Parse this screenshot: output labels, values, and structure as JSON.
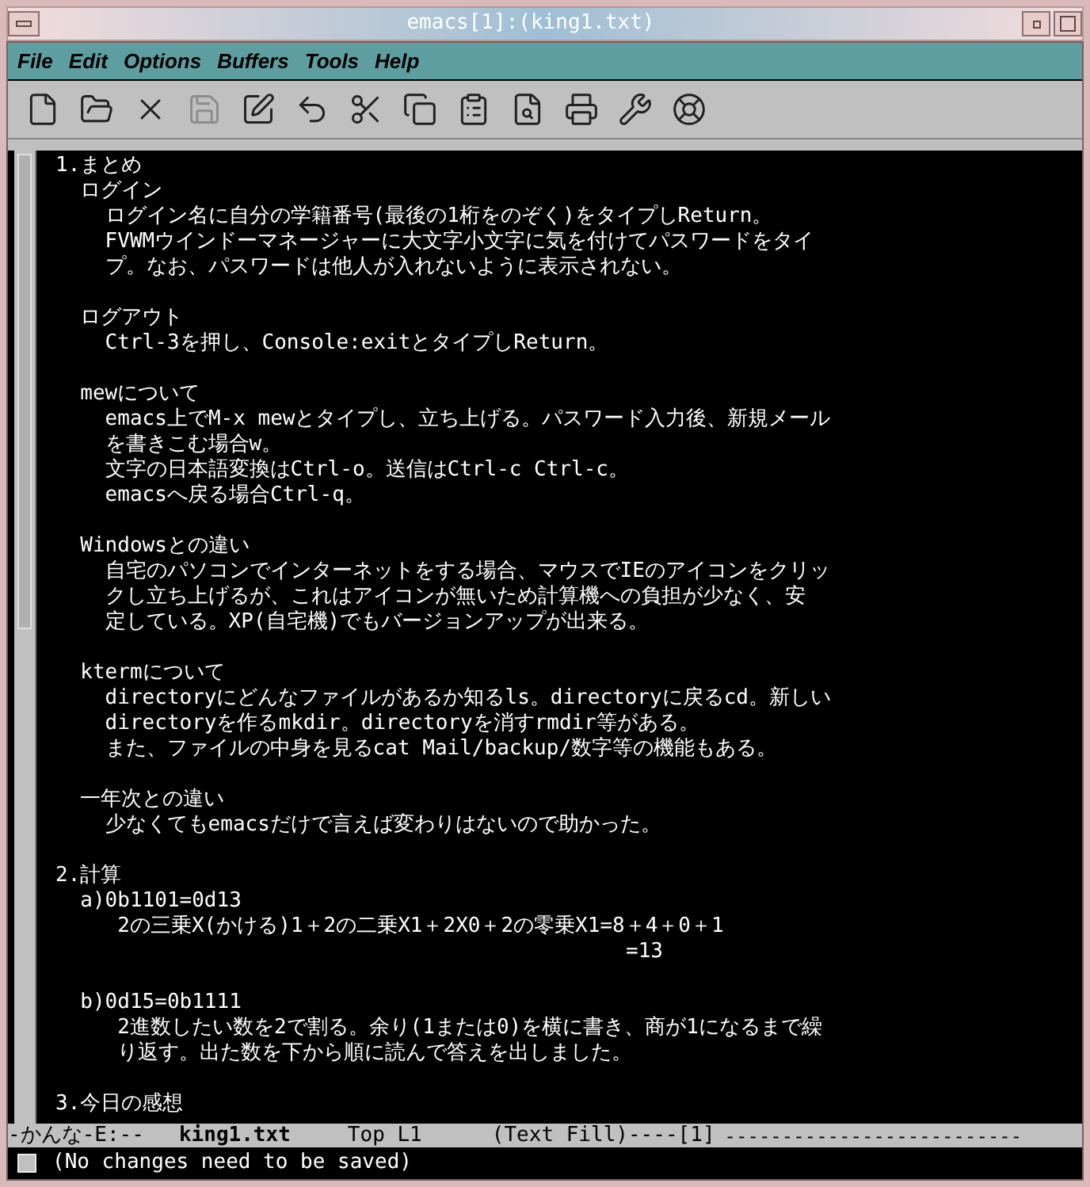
{
  "window": {
    "title": "emacs[1]:(king1.txt)"
  },
  "menu": [
    "File",
    "Edit",
    "Options",
    "Buffers",
    "Tools",
    "Help"
  ],
  "toolbar": [
    {
      "kind": "new",
      "disabled": false
    },
    {
      "kind": "open",
      "disabled": false
    },
    {
      "kind": "close",
      "disabled": false
    },
    {
      "kind": "save",
      "disabled": true
    },
    {
      "kind": "save-as",
      "disabled": false
    },
    {
      "kind": "undo",
      "disabled": false
    },
    {
      "kind": "cut",
      "disabled": false
    },
    {
      "kind": "copy",
      "disabled": false
    },
    {
      "kind": "paste",
      "disabled": false
    },
    {
      "kind": "search",
      "disabled": false
    },
    {
      "kind": "print",
      "disabled": false
    },
    {
      "kind": "tools",
      "disabled": false
    },
    {
      "kind": "help",
      "disabled": false
    }
  ],
  "buffer": [
    [
      "1.まとめ",
      "  ログイン",
      "    ログイン名に自分の学籍番号(最後の1桁をのぞく)をタイプしReturn。",
      "    FVWMウインドーマネージャーに大文字小文字に気を付けてパスワードをタイ",
      "    プ。なお、パスワードは他人が入れないように表示されない。"
    ],
    [
      "  ログアウト",
      "    Ctrl-3を押し、Console:exitとタイプしReturn。"
    ],
    [
      "  mewについて",
      "    emacs上でM-x mewとタイプし、立ち上げる。パスワード入力後、新規メール",
      "    を書きこむ場合w。",
      "    文字の日本語変換はCtrl-o。送信はCtrl-c Ctrl-c。",
      "    emacsへ戻る場合Ctrl-q。"
    ],
    [
      "  Windowsとの違い",
      "    自宅のパソコンでインターネットをする場合、マウスでIEのアイコンをクリッ",
      "    クし立ち上げるが、これはアイコンが無いため計算機への負担が少なく、安",
      "    定している。XP(自宅機)でもバージョンアップが出来る。"
    ],
    [
      "  ktermについて",
      "    directoryにどんなファイルがあるか知るls。directoryに戻るcd。新しい",
      "    directoryを作るmkdir。directoryを消すrmdir等がある。",
      "    また、ファイルの中身を見るcat Mail/backup/数字等の機能もある。"
    ],
    [
      "  一年次との違い",
      "    少なくてもemacsだけで言えば変わりはないので助かった。"
    ],
    [
      "2.計算",
      "  a)0b1101=0d13",
      "     2の三乗X(かける)1＋2の二乗X1＋2X0＋2の零乗X1=8＋4＋0＋1",
      "                                              =13"
    ],
    [
      "  b)0d15=0b1111",
      "     2進数したい数を2で割る。余り(1または0)を横に書き、商が1になるまで繰",
      "     り返す。出た数を下から順に読んで答えを出しました。"
    ],
    [
      "3.今日の感想"
    ]
  ],
  "mode_line": {
    "status": "-かんな-E:--",
    "buffer_name": "king1.txt",
    "position": "Top L1",
    "mode": "(Text Fill)----[1]",
    "fill": "--------------------------"
  },
  "echo_area": "(No changes need to be saved)"
}
